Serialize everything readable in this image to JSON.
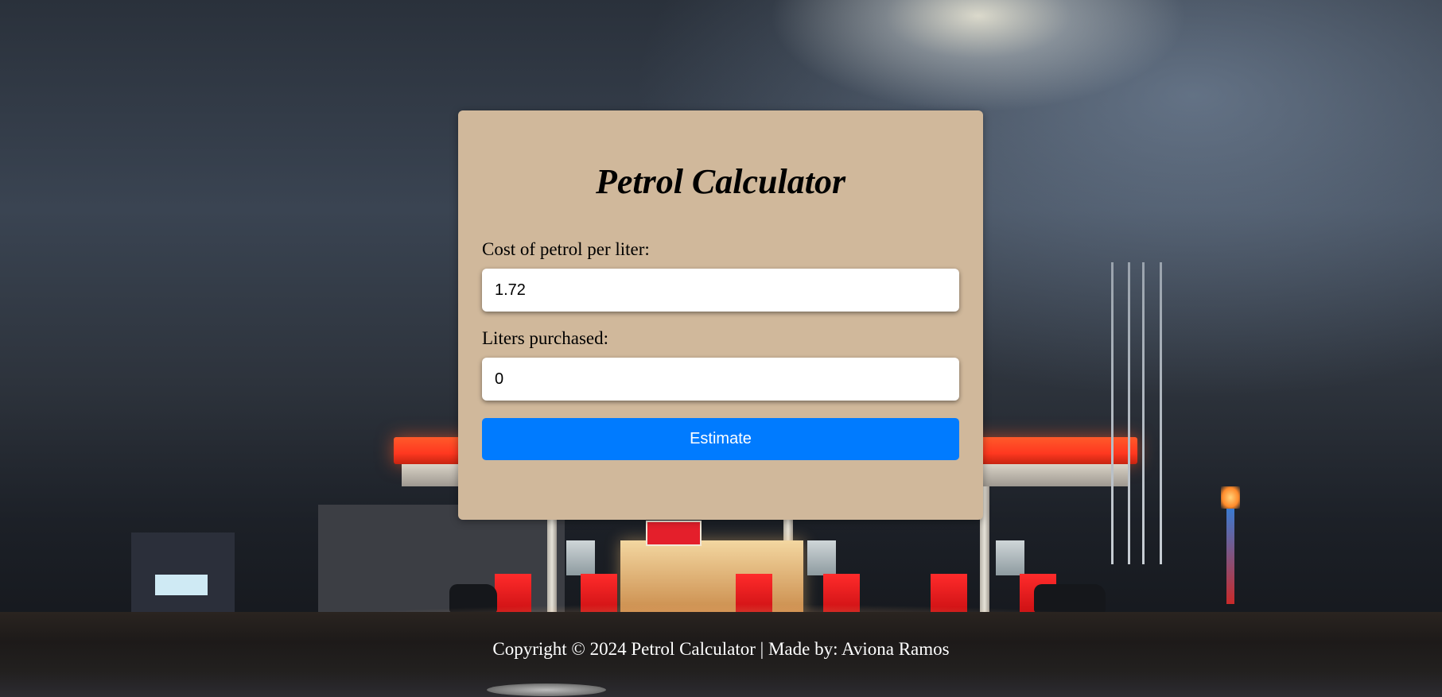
{
  "app": {
    "title": "Petrol Calculator"
  },
  "form": {
    "cost_label": "Cost of petrol per liter:",
    "cost_value": "1.72",
    "liters_label": "Liters purchased:",
    "liters_value": "0",
    "estimate_label": "Estimate"
  },
  "footer": {
    "text": "Copyright © 2024 Petrol Calculator | Made by: Aviona Ramos"
  },
  "colors": {
    "card_background": "#d0b89b",
    "button": "#007bff",
    "button_text": "#ffffff",
    "footer_text": "#ffffff"
  }
}
